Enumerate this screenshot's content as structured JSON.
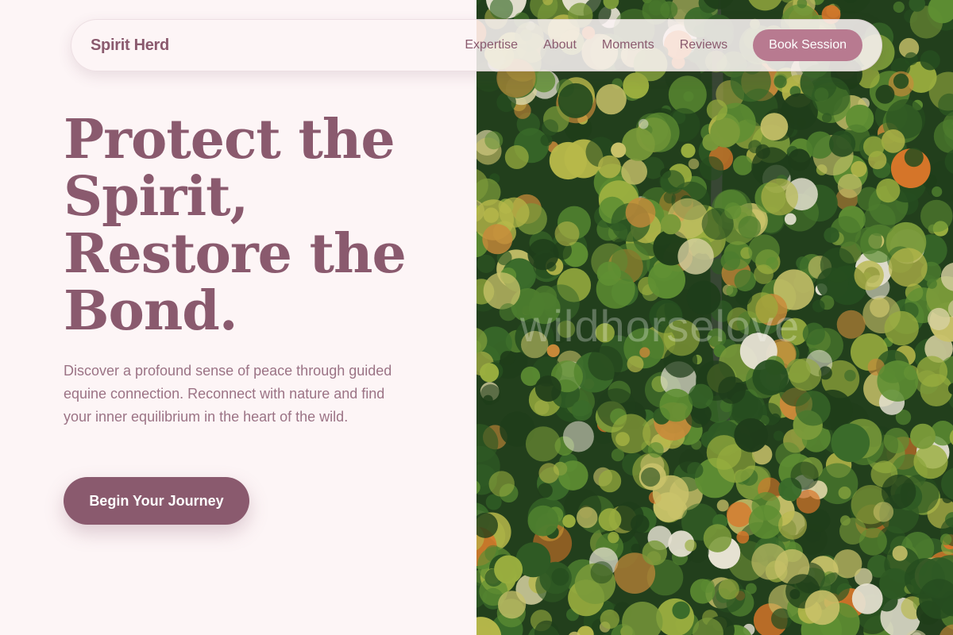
{
  "nav": {
    "brand": "Spirit Herd",
    "links": [
      "Expertise",
      "About",
      "Moments",
      "Reviews"
    ],
    "cta": "Book Session"
  },
  "hero": {
    "title_lines": [
      "Protect the",
      "Spirit,",
      "Restore the",
      "Bond."
    ],
    "description": "Discover a profound sense of peace through guided equine connection. Reconnect with nature and find your inner equilibrium in the heart of the wild.",
    "cta": "Begin Your Journey"
  },
  "image": {
    "watermark": "wildhorselove"
  },
  "colors": {
    "primary": "#8a5a6e",
    "accent": "#b87a90",
    "background": "#fdf5f6",
    "body_text": "#9b7385"
  }
}
